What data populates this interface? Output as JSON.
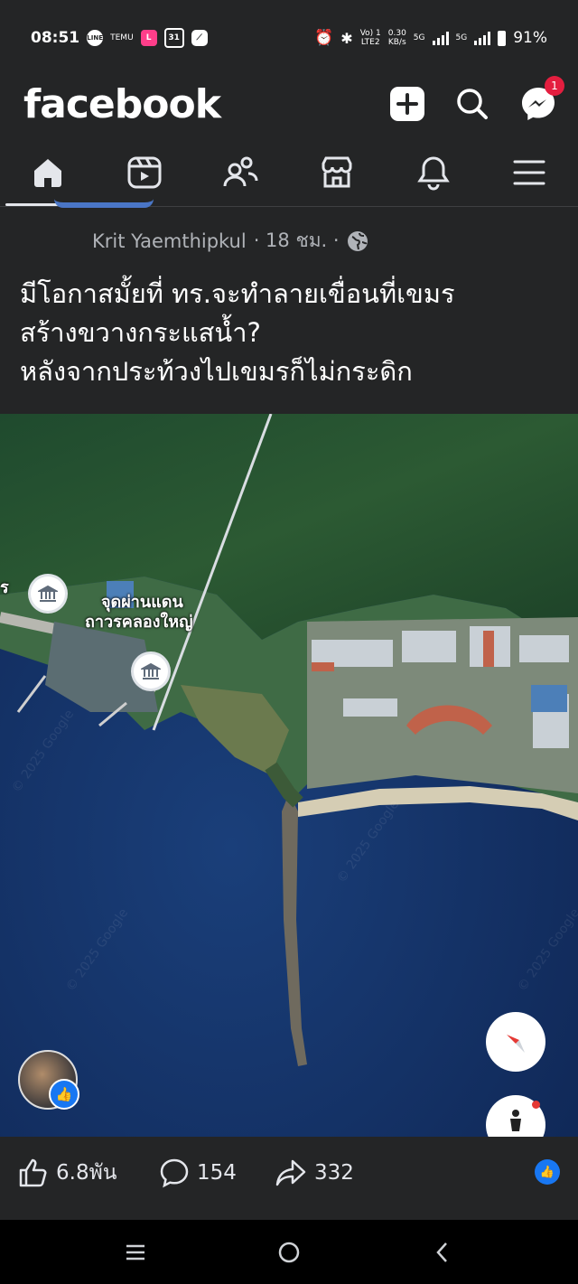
{
  "status": {
    "time": "08:51",
    "app_icons": [
      "line-icon",
      "temu-icon",
      "lazada-icon",
      "calendar-icon",
      "link-icon"
    ],
    "calendar_day": "31",
    "temu_label": "TEMU",
    "volte": "Vo) 1",
    "lte": "LTE2",
    "speed": "0.30",
    "speed_unit": "KB/s",
    "net1": "5G",
    "net2": "5G",
    "battery": "91%"
  },
  "header": {
    "logo": "facebook",
    "messenger_badge": "1"
  },
  "tabs": [
    "home",
    "video",
    "friends",
    "marketplace",
    "notifications",
    "menu"
  ],
  "post": {
    "author": "Krit Yaemthipkul",
    "meta": "· 18 ชม. ·",
    "text_lines": [
      "มีโอกาสมั้ยที่ ทร.จะทำลายเขื่อนที่เขมร",
      "สร้างขวางกระแสน้ำ?",
      "หลังจากประท้วงไปเขมรก็ไม่กระดิก"
    ],
    "map": {
      "label_line1": "จุดผ่านแดน",
      "label_line2": "ถาวรคลองใหญ่",
      "edge_label": "ร"
    }
  },
  "reactions": {
    "likes": "6.8พัน",
    "comments": "154",
    "shares": "332"
  },
  "colors": {
    "background": "#242526",
    "accent": "#1877f2",
    "badge": "#e41e3f"
  }
}
